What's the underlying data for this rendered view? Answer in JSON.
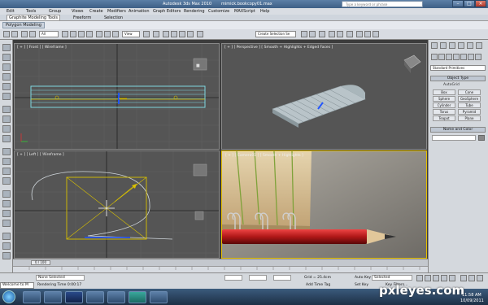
{
  "window": {
    "app_title": "Autodesk 3ds Max 2010",
    "file_title": "mimick.bookcopy01.max",
    "search_placeholder": "Type a keyword or phrase"
  },
  "menu": [
    "Edit",
    "Tools",
    "Group",
    "Views",
    "Create",
    "Modifiers",
    "Animation",
    "Graph Editors",
    "Rendering",
    "Customize",
    "MAXScript",
    "Help"
  ],
  "ribbon": {
    "tabs": [
      "Graphite Modeling Tools",
      "Freeform",
      "Selection"
    ],
    "sub_button": "Polygon Modeling"
  },
  "toolbar": {
    "filter_value": "All",
    "view_value": "View",
    "named_sel_placeholder": "Create Selection Se"
  },
  "viewports": {
    "front": "[ + ] [ Front ] [ Wireframe ]",
    "perspective": "[ + ] [ Perspective ] [ Smooth + Highlights + Edged Faces ]",
    "left": "[ + ] [ Left ] [ Wireframe ]",
    "camera": "[ + ] [ Camera01 ] [ Smooth + Highlights ]"
  },
  "command_panel": {
    "dropdown": "Standard Primitives",
    "object_type_header": "Object Type",
    "autogrid": "AutoGrid",
    "buttons": [
      "Box",
      "Cone",
      "Sphere",
      "GeoSphere",
      "Cylinder",
      "Tube",
      "Torus",
      "Pyramid",
      "Teapot",
      "Plane"
    ],
    "name_color_header": "Name and Color"
  },
  "timeline": {
    "frame_counter": "0 / 100"
  },
  "status": {
    "selection": "None Selected",
    "render_time": "Rendering Time 0:00:17",
    "grid": "Grid = 25.4cm",
    "add_time_tag": "Add Time Tag",
    "auto_key": "Auto Key",
    "selected_value": "Selected",
    "set_key": "Set Key",
    "key_filters": "Key Filters...",
    "welcome": "Welcome to M"
  },
  "taskbar": {
    "time": "11:58 AM",
    "date": "10/09/2011"
  },
  "watermark": "pxleyes.com",
  "colors": {
    "viewport_bg": "#555555",
    "active_border": "#e6c000",
    "wire_cyan": "#7fd6e0",
    "wire_yellow": "#d8c000",
    "taskbar": "#2a4463"
  }
}
